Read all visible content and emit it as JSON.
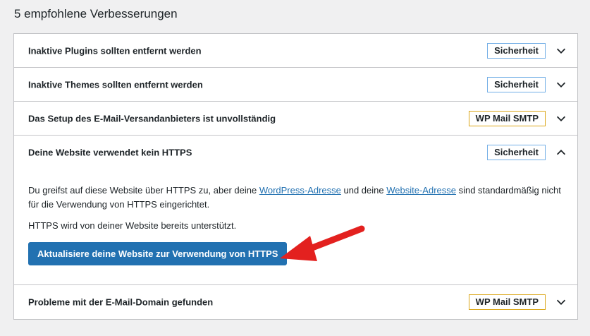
{
  "heading": "5 empfohlene Verbesserungen",
  "items": [
    {
      "title": "Inaktive Plugins sollten entfernt werden",
      "badge": "Sicherheit"
    },
    {
      "title": "Inaktive Themes sollten entfernt werden",
      "badge": "Sicherheit"
    },
    {
      "title": "Das Setup des E-Mail-Versandanbieters ist unvollständig",
      "badge": "WP Mail SMTP"
    },
    {
      "title": "Deine Website verwendet kein HTTPS",
      "badge": "Sicherheit"
    },
    {
      "title": "Probleme mit der E-Mail-Domain gefunden",
      "badge": "WP Mail SMTP"
    }
  ],
  "expanded": {
    "text_before": "Du greifst auf diese Website über HTTPS zu, aber deine ",
    "link1": "WordPress-Adresse",
    "text_middle": " und deine ",
    "link2": "Website-Adresse",
    "text_after": " sind standardmäßig nicht für die Verwendung von HTTPS eingerichtet.",
    "supported": "HTTPS wird von deiner Website bereits unterstützt.",
    "button": "Aktualisiere deine Website zur Verwendung von HTTPS"
  },
  "colors": {
    "button": "#2271b1",
    "badge_security_border": "#72aee6",
    "badge_smtp_border": "#dba617",
    "arrow": "#e3211f"
  }
}
